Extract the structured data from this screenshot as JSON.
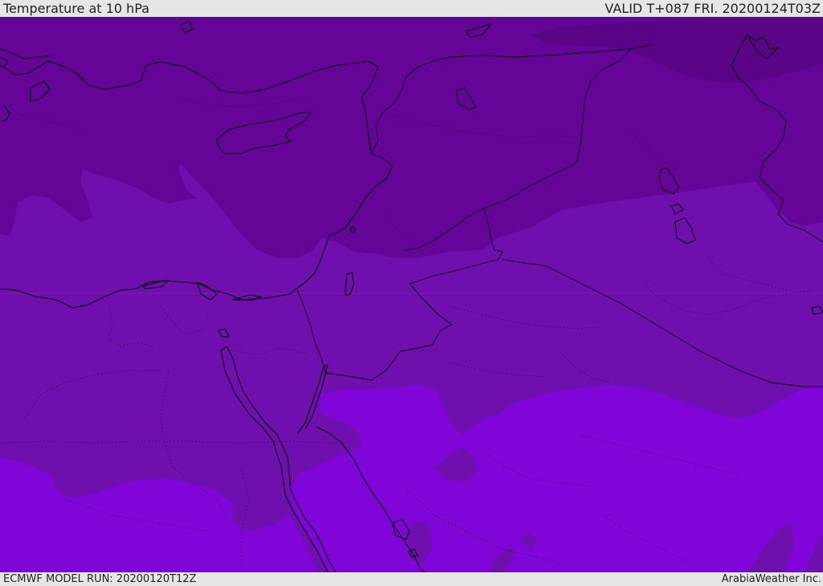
{
  "header": {
    "title": "Temperature at 10 hPa",
    "valid": "VALID T+087 FRI. 20200124T03Z"
  },
  "footer": {
    "model_run": "ECMWF MODEL RUN: 20200120T12Z",
    "credit": "ArabiaWeather Inc."
  },
  "map": {
    "colors": {
      "darkest": "#5a0488",
      "dark": "#640598",
      "mid": "#7010b0",
      "light": "#7f05d8",
      "coast": "#000000"
    }
  }
}
